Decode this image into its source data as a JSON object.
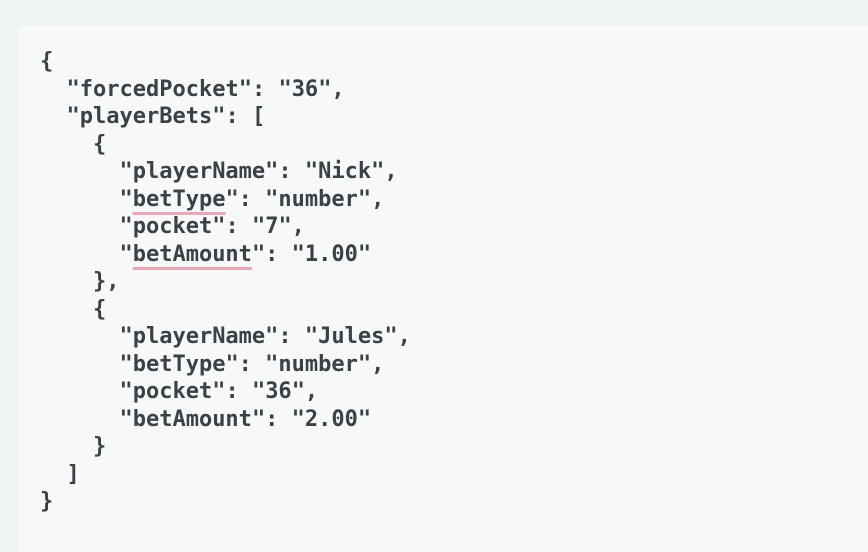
{
  "json_text": {
    "open_brace": "{",
    "close_brace": "}",
    "forced_pocket_key": "forcedPocket",
    "forced_pocket_value": "36",
    "player_bets_key": "playerBets",
    "open_bracket": "[",
    "close_bracket": "]",
    "bets": [
      {
        "player_name_key": "playerName",
        "player_name_value": "Nick",
        "bet_type_key": "betType",
        "bet_type_value": "number",
        "pocket_key": "pocket",
        "pocket_value": "7",
        "bet_amount_key": "betAmount",
        "bet_amount_value": "1.00"
      },
      {
        "player_name_key": "playerName",
        "player_name_value": "Jules",
        "bet_type_key": "betType",
        "bet_type_value": "number",
        "pocket_key": "pocket",
        "pocket_value": "36",
        "bet_amount_key": "betAmount",
        "bet_amount_value": "2.00"
      }
    ]
  },
  "colors": {
    "page_background": "#eef4f0",
    "card_background": "#f7f9f8",
    "text": "#3b4149",
    "highlight_underline": "#f0a5b3"
  }
}
